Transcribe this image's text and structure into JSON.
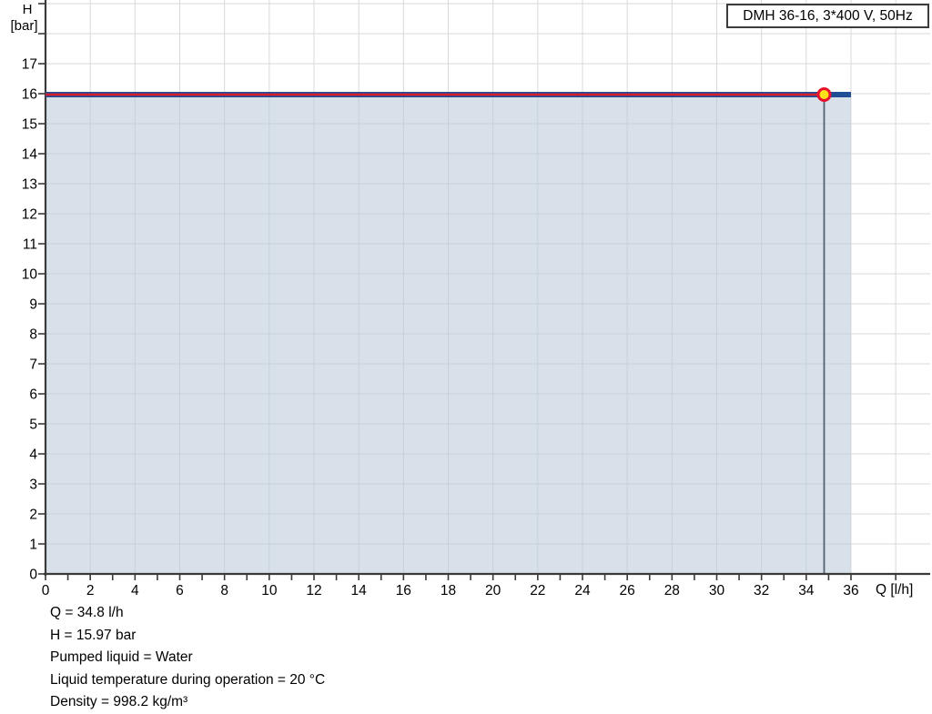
{
  "legend": {
    "label": "DMH 36-16, 3*400 V, 50Hz"
  },
  "axes": {
    "y_unit_line1": "H",
    "y_unit_line2": "[bar]",
    "x_unit": "Q [l/h]"
  },
  "chart_data": {
    "type": "line",
    "title": "DMH 36-16, 3*400 V, 50Hz",
    "xlabel": "Q [l/h]",
    "ylabel": "H [bar]",
    "x_axis": {
      "min": 0,
      "max": 38,
      "tick_step": 1,
      "tick_range_end": 36,
      "extra_ticks": [
        38
      ],
      "grid_step": 2,
      "labeled_ticks": [
        0,
        2,
        4,
        6,
        8,
        10,
        12,
        14,
        16,
        18,
        20,
        22,
        24,
        26,
        28,
        30,
        32,
        34,
        36
      ]
    },
    "y_axis": {
      "min": 0,
      "max": 19,
      "tick_step": 1,
      "grid_step": 1,
      "labeled_ticks": [
        0,
        1,
        2,
        3,
        4,
        5,
        6,
        7,
        8,
        9,
        10,
        11,
        12,
        13,
        14,
        15,
        16,
        17
      ]
    },
    "series": [
      {
        "name": "pump-curve",
        "color": "#1f4e97",
        "x": [
          0,
          36
        ],
        "y": [
          15.97,
          15.97
        ]
      },
      {
        "name": "duty-segment",
        "color": "#d01f2e",
        "x": [
          0,
          34.8
        ],
        "y": [
          15.97,
          15.97
        ]
      }
    ],
    "area_under_curve": {
      "x_range": [
        0,
        36
      ],
      "top_h": 15.97,
      "fill": "#b8c9d9"
    },
    "operating_point": {
      "q": 34.8,
      "h": 15.97,
      "fill": "#ffe11a",
      "stroke": "#e8112d"
    },
    "drop_line": {
      "q": 34.8,
      "color": "#56626f"
    },
    "colors": {
      "grid": "#d9d9d9",
      "axis": "#3a3a3a"
    },
    "legend_position": "top-right",
    "grid": "on"
  },
  "info": {
    "lines": [
      "Q = 34.8 l/h",
      "H = 15.97 bar",
      "Pumped liquid = Water",
      "Liquid temperature during operation = 20 °C",
      "Density = 998.2 kg/m³"
    ]
  }
}
